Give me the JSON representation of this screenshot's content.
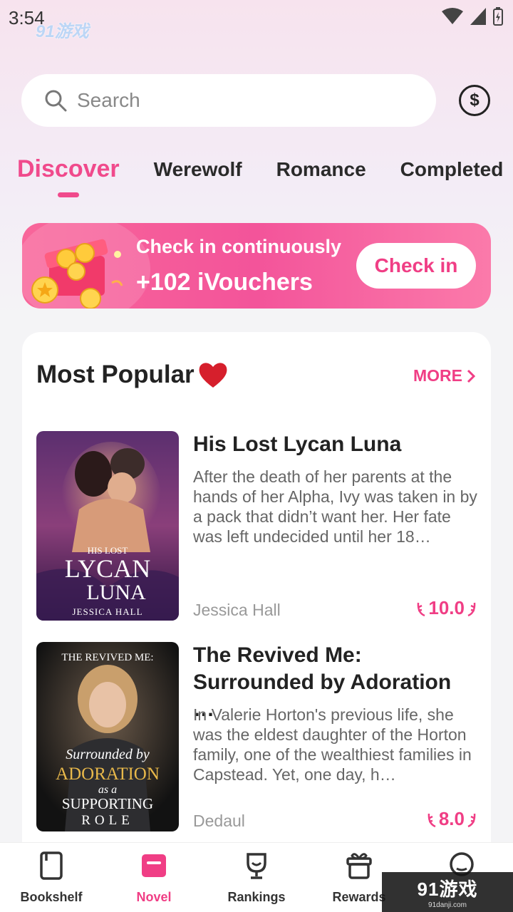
{
  "status_bar": {
    "time": "3:54"
  },
  "corner_logo": "91游戏",
  "search": {
    "placeholder": "Search"
  },
  "tabs": [
    {
      "label": "Discover",
      "active": true
    },
    {
      "label": "Werewolf",
      "active": false
    },
    {
      "label": "Romance",
      "active": false
    },
    {
      "label": "Completed",
      "active": false
    }
  ],
  "checkin": {
    "line1": "Check in continuously",
    "line2": "+102 iVouchers",
    "button": "Check in"
  },
  "popular": {
    "title": "Most Popular",
    "more": "MORE",
    "books": [
      {
        "title": "His Lost Lycan Luna",
        "description": "After the death of her parents at the hands of her Alpha, Ivy was taken in by a pack that didn’t want her. Her fate was left undecided until her 18…",
        "author": "Jessica Hall",
        "score": "10.0",
        "cover": {
          "line1": "HIS LOST",
          "line2": "LYCAN",
          "line3": "LUNA",
          "author": "JESSICA HALL"
        }
      },
      {
        "title": "The Revived Me: Surrounded by Adoration …",
        "description": "In Valerie Horton's previous life, she was the eldest daughter of the Horton family, one of the wealthiest families in Capstead. Yet, one day, h…",
        "author": "Dedaul",
        "score": "8.0",
        "cover": {
          "line1": "THE REVIVED ME:",
          "line2": "Surrounded by",
          "line3": "ADORATION",
          "line4": "as a",
          "line5": "SUPPORTING",
          "line6": "ROLE"
        }
      }
    ]
  },
  "bottom_nav": [
    {
      "label": "Bookshelf",
      "active": false
    },
    {
      "label": "Novel",
      "active": true
    },
    {
      "label": "Rankings",
      "active": false
    },
    {
      "label": "Rewards",
      "active": false
    },
    {
      "label": "",
      "active": false
    }
  ],
  "watermark": {
    "main": "91游戏",
    "sub": "91danji.com"
  },
  "colors": {
    "accent": "#f03e85",
    "banner": "#f7619c",
    "text": "#222222"
  }
}
